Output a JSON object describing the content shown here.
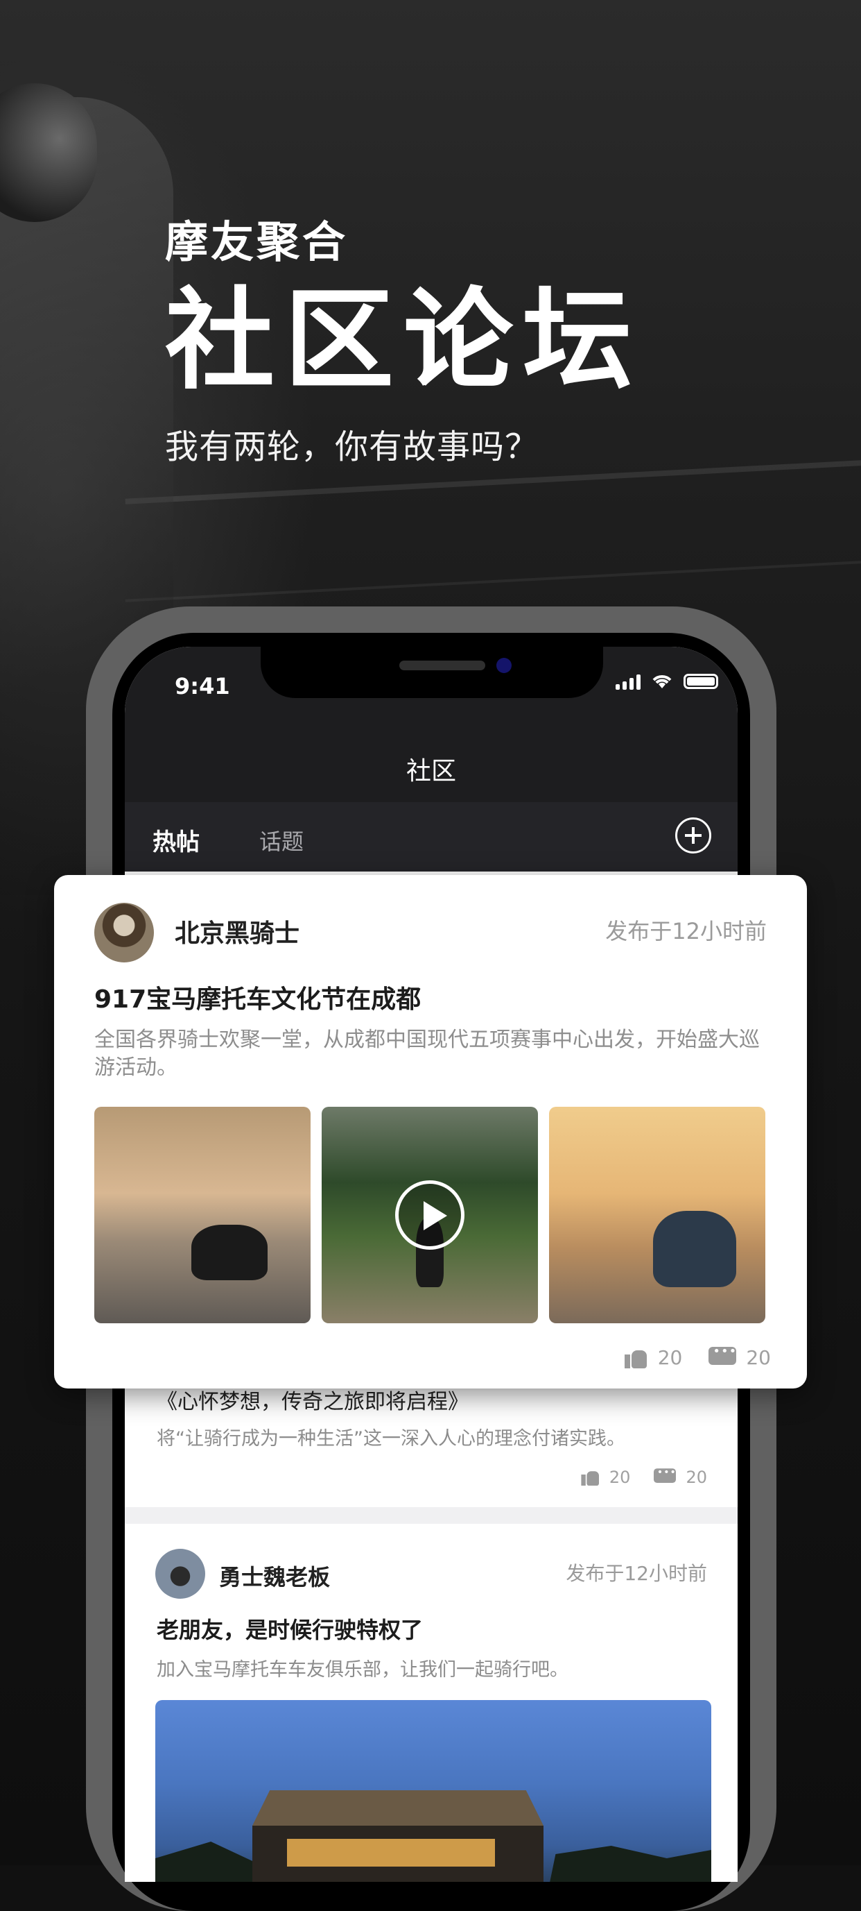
{
  "hero": {
    "subtitle": "摩友聚合",
    "title": "社区论坛",
    "tagline": "我有两轮，你有故事吗？"
  },
  "status_bar": {
    "time": "9:41"
  },
  "app": {
    "nav_title": "社区",
    "tabs": [
      {
        "label": "热帖",
        "active": true
      },
      {
        "label": "话题",
        "active": false
      }
    ],
    "add_icon": "plus-circle-icon"
  },
  "featured_post": {
    "author": "北京黑骑士",
    "time": "发布于12小时前",
    "title": "917宝马摩托车文化节在成都",
    "description": "全国各界骑士欢聚一堂，从成都中国现代五项赛事中心出发，开始盛大巡游活动。",
    "images": [
      "city-street-motorcycle-photo",
      "forest-road-rider-video",
      "sunset-terrace-scooter-photo"
    ],
    "likes": "20",
    "comments": "20"
  },
  "post2": {
    "title": "《心怀梦想，传奇之旅即将启程》",
    "description": "将“让骑行成为一种生活”这一深入人心的理念付诸实践。",
    "likes": "20",
    "comments": "20"
  },
  "post3": {
    "author": "勇士魏老板",
    "time": "发布于12小时前",
    "title": "老朋友，是时候行驶特权了",
    "description": "加入宝马摩托车车友俱乐部，让我们一起骑行吧。"
  },
  "colors": {
    "background": "#111111",
    "nav_bar": "#1d1d1f",
    "tab_bar": "#242428",
    "phone_frame": "#616161"
  }
}
